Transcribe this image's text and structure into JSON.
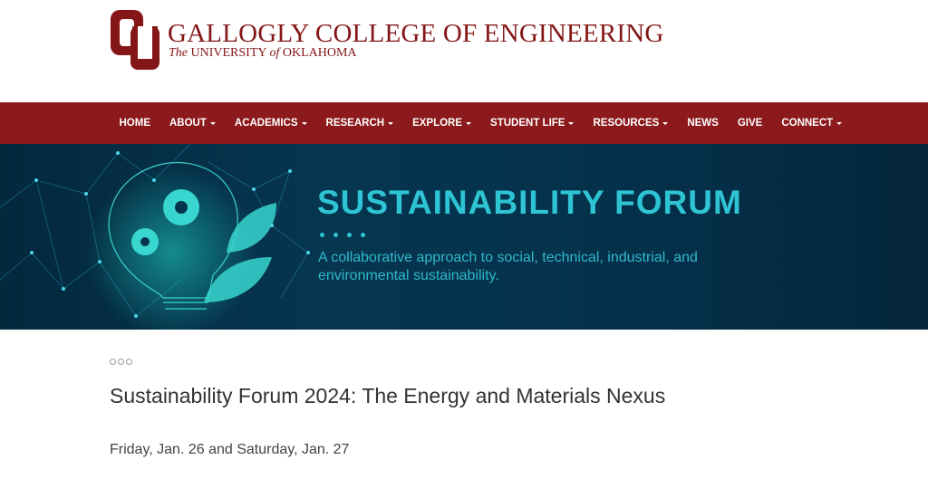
{
  "header": {
    "college_name": "GALLOGLY COLLEGE OF ENGINEERING",
    "univ_the": "The",
    "univ_part1": "UNIVERSITY",
    "univ_of": "of",
    "univ_part2": "OKLAHOMA",
    "logo_icon": "ou-interlocking-logo",
    "brand_color": "#841617"
  },
  "nav": {
    "items": [
      {
        "label": "HOME",
        "dropdown": false
      },
      {
        "label": "ABOUT",
        "dropdown": true
      },
      {
        "label": "ACADEMICS",
        "dropdown": true
      },
      {
        "label": "RESEARCH",
        "dropdown": true
      },
      {
        "label": "EXPLORE",
        "dropdown": true
      },
      {
        "label": "STUDENT LIFE",
        "dropdown": true
      },
      {
        "label": "RESOURCES",
        "dropdown": true
      },
      {
        "label": "NEWS",
        "dropdown": false
      },
      {
        "label": "GIVE",
        "dropdown": false
      },
      {
        "label": "CONNECT",
        "dropdown": true
      }
    ],
    "bg_color": "#8c1a1c"
  },
  "banner": {
    "title": "SUSTAINABILITY FORUM",
    "subtitle": "A collaborative approach to social, technical, industrial, and environmental sustainability.",
    "accent_color": "#2ec4d4",
    "illustration_icon": "lightbulb-gears-leaves-icon"
  },
  "main": {
    "breadcrumb_icon": "breadcrumb-dots-icon",
    "title": "Sustainability Forum 2024: The Energy and Materials Nexus",
    "date": "Friday, Jan. 26 and Saturday, Jan. 27"
  }
}
